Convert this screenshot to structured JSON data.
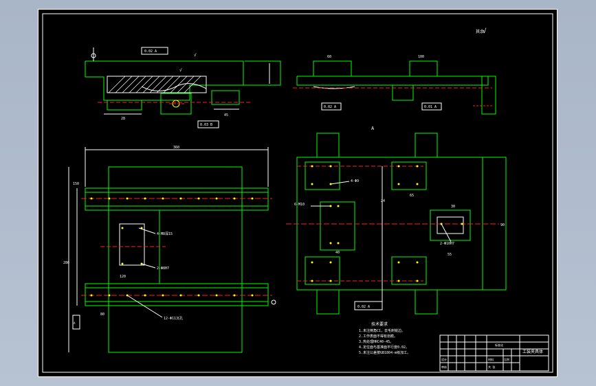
{
  "sheet": {
    "title_block": {
      "drawing_name": "工装夹具体",
      "scale_label": "比例",
      "sheet_label": "共 张",
      "designer_label": "设计",
      "checker_label": "审核",
      "material_label": "材料",
      "header_label": "标准化"
    },
    "surface_mark": "其余",
    "section_label": "A",
    "notes": {
      "heading": "技术要求",
      "lines": [
        "1.未注倒角C1，去毛刺锐边。",
        "2.工作表面不得有划痕。",
        "3.热处理HRC40-45。",
        "4.定位面与基准面平行度0.02。",
        "5.未注公差按GB1804-m级加工。"
      ]
    },
    "callouts": {
      "hole_a": "4-M8深15",
      "hole_b": "2-Φ8H7",
      "hole_c": "4-Φ9",
      "hole_d": "6-M10",
      "hole_e": "2-Φ10H7",
      "hole_f": "12-Φ11沉孔",
      "tol_1": "0.02 A",
      "tol_2": "0.03 B",
      "tol_3": "0.02 A",
      "tol_4": "0.01 A",
      "tol_5": "0.02 A",
      "datum": "A"
    },
    "dims": {
      "front_width": "360",
      "front_height": "280",
      "left_height": "150",
      "small_1": "28",
      "small_2": "45",
      "small_3": "60",
      "small_4": "100",
      "small_5": "120",
      "small_6": "80",
      "small_7": "65",
      "small_8": "40",
      "small_9": "30",
      "small_10": "24",
      "small_11": "55",
      "small_12": "90"
    }
  },
  "colors": {
    "outline": "#00ff00",
    "center_line": "#ff2020",
    "dim": "#ffffff",
    "hole": "#ffff00",
    "background": "#000000"
  }
}
